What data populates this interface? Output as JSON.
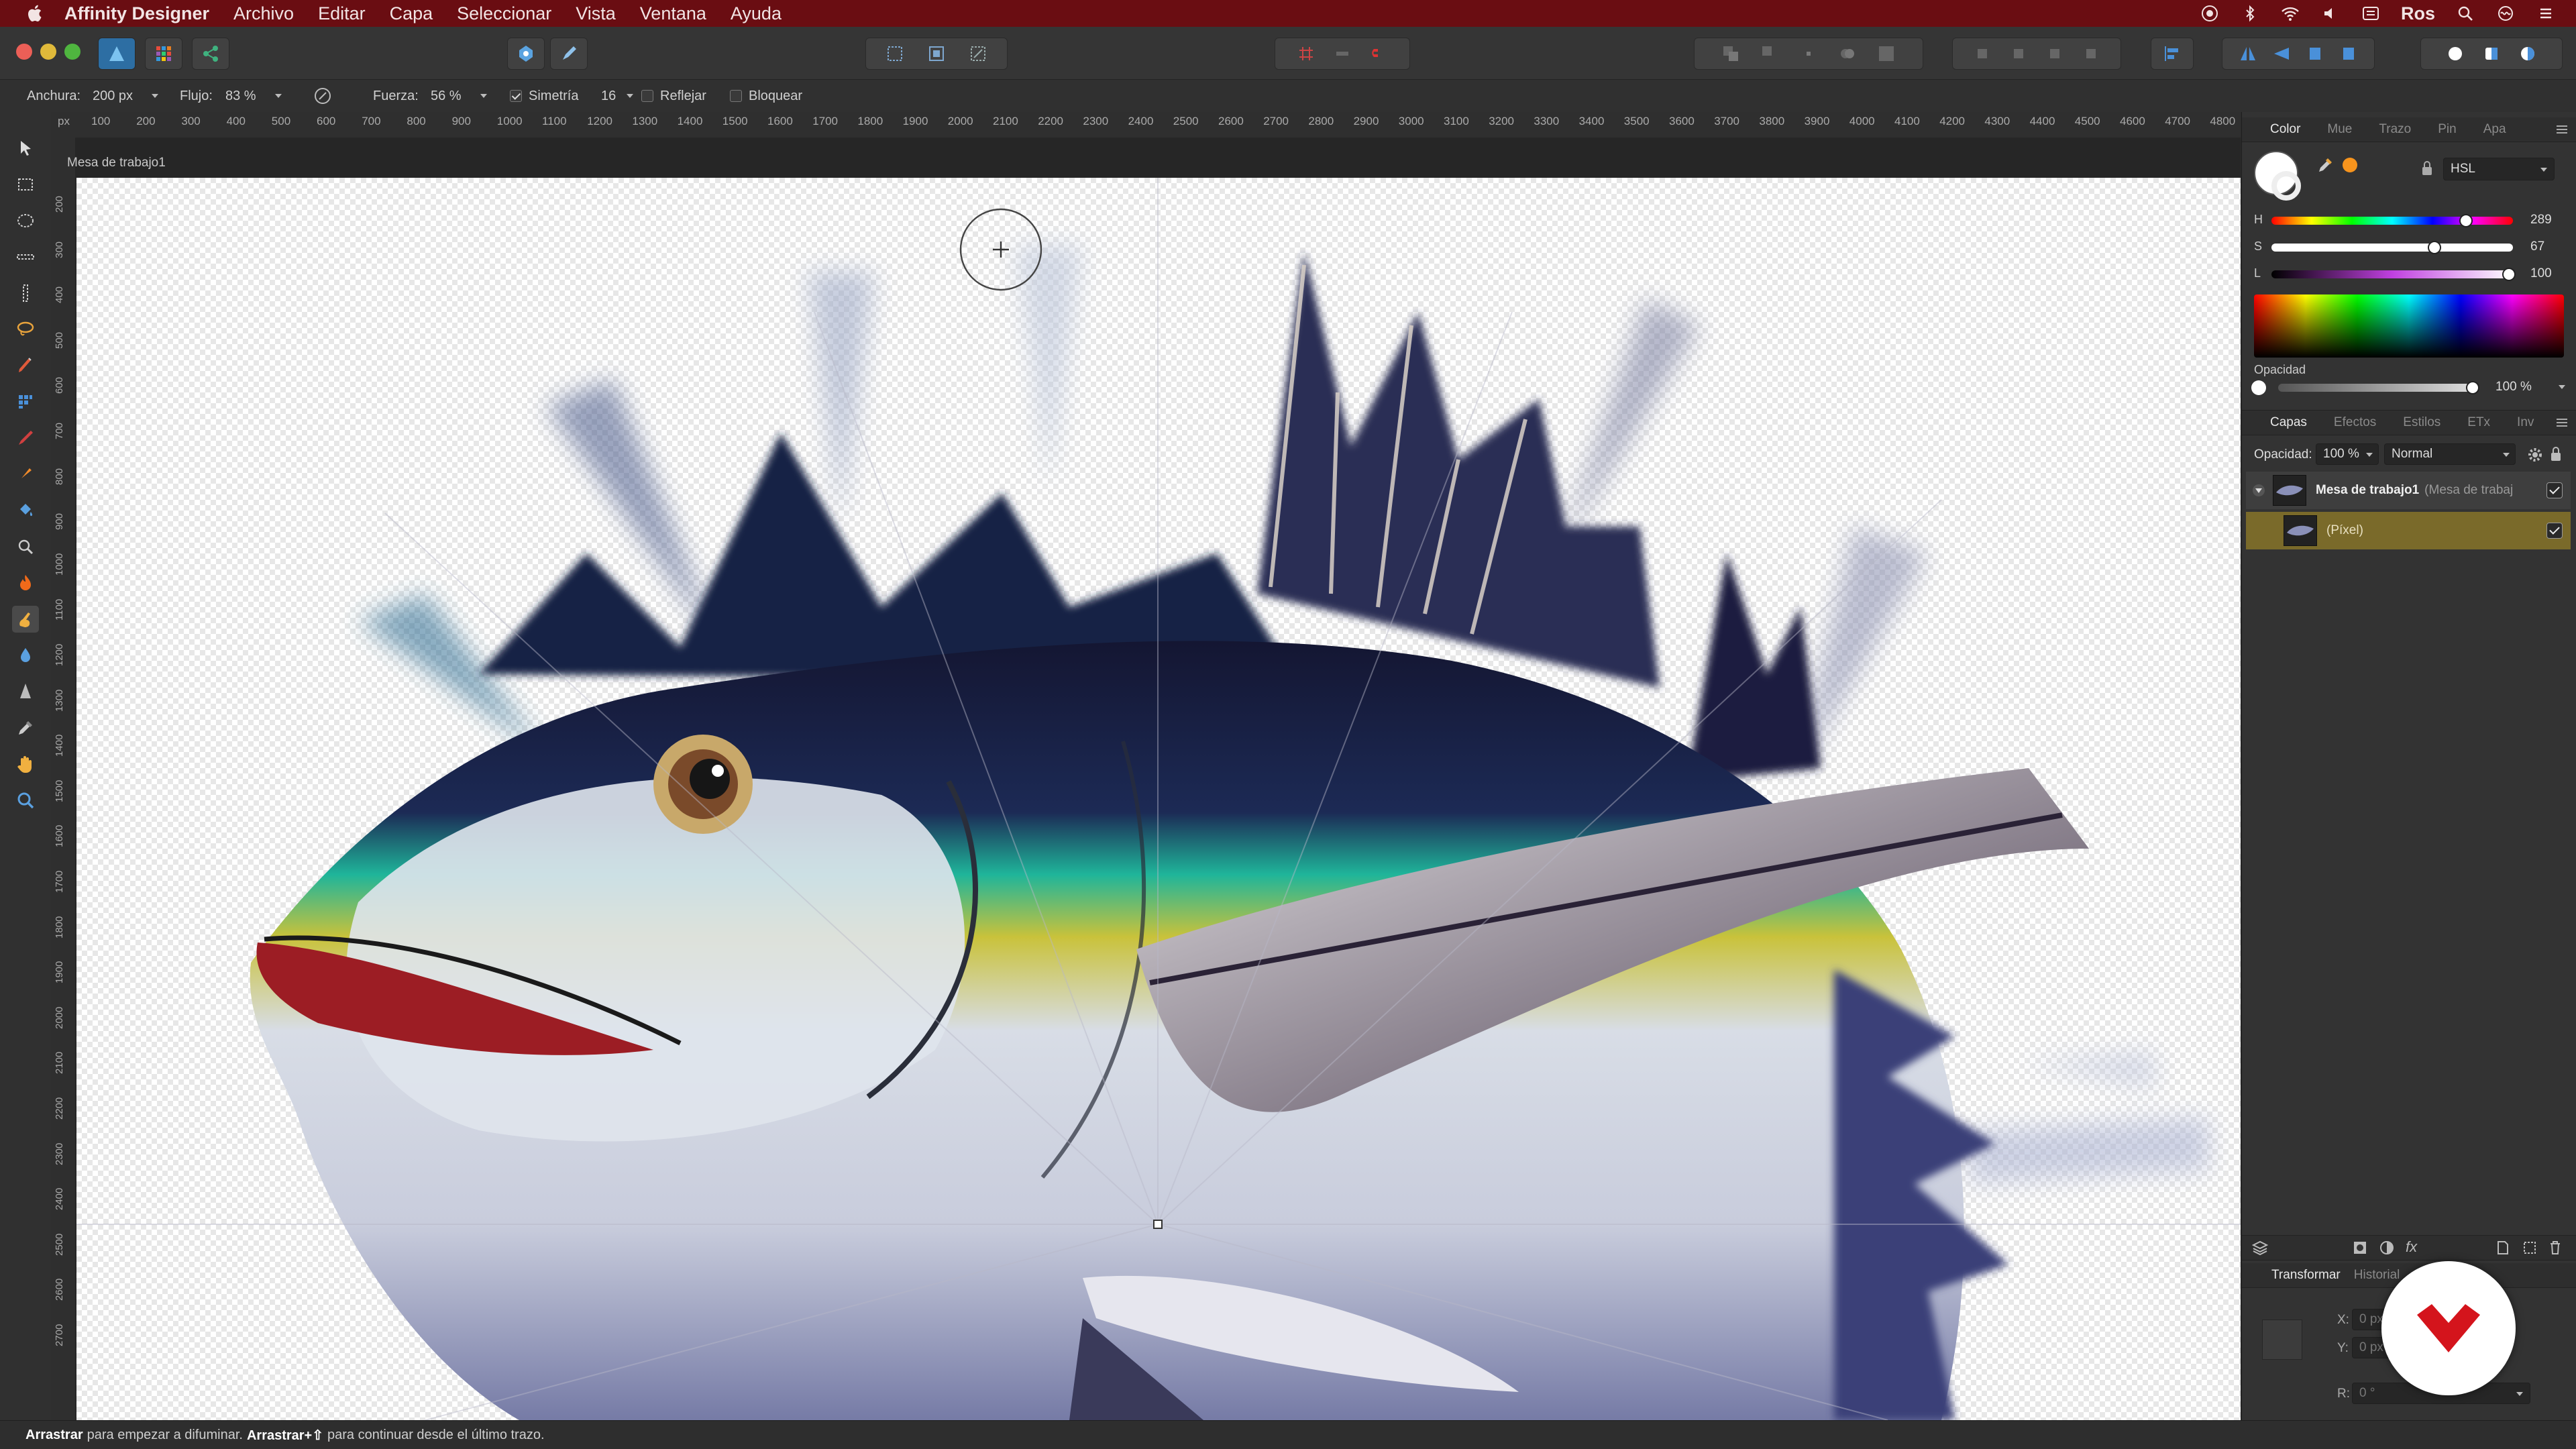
{
  "menubar": {
    "app_name": "Affinity Designer",
    "items": [
      "Archivo",
      "Editar",
      "Capa",
      "Seleccionar",
      "Vista",
      "Ventana",
      "Ayuda"
    ],
    "user": "Ros"
  },
  "context": {
    "width_label": "Anchura:",
    "width_value": "200 px",
    "flow_label": "Flujo:",
    "flow_value": "83 %",
    "force_label": "Fuerza:",
    "force_value": "56 %",
    "symmetry_label": "Simetría",
    "symmetry_checked": true,
    "symmetry_value": "16",
    "mirror_label": "Reflejar",
    "lock_label": "Bloquear"
  },
  "ruler": {
    "unit": "px",
    "top_ticks": [
      "100",
      "200",
      "300",
      "400",
      "500",
      "600",
      "700",
      "800",
      "900",
      "1000",
      "1100",
      "1200",
      "1300",
      "1400",
      "1500",
      "1600",
      "1700",
      "1800",
      "1900",
      "2000",
      "2100",
      "2200",
      "2300",
      "2400",
      "2500",
      "2600",
      "2700",
      "2800",
      "2900",
      "3000",
      "3100",
      "3200",
      "3300",
      "3400",
      "3500",
      "3600",
      "3700",
      "3800",
      "3900",
      "4000",
      "4100",
      "4200",
      "4300",
      "4400",
      "4500",
      "4600",
      "4700",
      "4800"
    ],
    "left_ticks": [
      "200",
      "300",
      "400",
      "500",
      "600",
      "700",
      "800",
      "900",
      "1000",
      "1100",
      "1200",
      "1300",
      "1400",
      "1500",
      "1600",
      "1700",
      "1800",
      "1900",
      "2000",
      "2100",
      "2200",
      "2300",
      "2400",
      "2500",
      "2600",
      "2700"
    ]
  },
  "canvas": {
    "artboard_title": "Mesa de trabajo1"
  },
  "color_panel": {
    "tabs": [
      "Color",
      "Mue",
      "Trazo",
      "Pin",
      "Apa"
    ],
    "active_tab": "Color",
    "mode": "HSL",
    "h_label": "H",
    "h_value": "289",
    "h_fraction": 0.8,
    "s_label": "S",
    "s_value": "67",
    "s_fraction": 0.67,
    "l_label": "L",
    "l_value": "100",
    "l_fraction": 1.0,
    "opacity_label": "Opacidad",
    "opacity_value": "100 %",
    "fill_color": "#ffffff",
    "accent_color": "#f7941d"
  },
  "layers_panel": {
    "tabs": [
      "Capas",
      "Efectos",
      "Estilos",
      "ETx",
      "Inv"
    ],
    "active_tab": "Capas",
    "opacity_label": "Opacidad:",
    "opacity_value": "100 %",
    "blend_mode": "Normal",
    "layers": [
      {
        "name": "Mesa de trabajo1",
        "type": "(Mesa de trabaj"
      },
      {
        "name": "(Píxel)"
      }
    ],
    "selected_color": "#7a6a2a"
  },
  "transform_panel": {
    "tabs": [
      "Transformar",
      "Historial"
    ],
    "active_tab": "Transformar",
    "x_label": "X:",
    "x_value": "0 px",
    "y_label": "Y:",
    "y_value": "0 px",
    "r_label": "R:",
    "r_value": "0 °"
  },
  "statusbar": {
    "drag": "Arrastrar",
    "text1": "para empezar a difuminar.",
    "drag_shift": "Arrastrar+⇧",
    "text2": "para continuar desde el último trazo."
  },
  "brand": {
    "color": "#d4141c"
  }
}
